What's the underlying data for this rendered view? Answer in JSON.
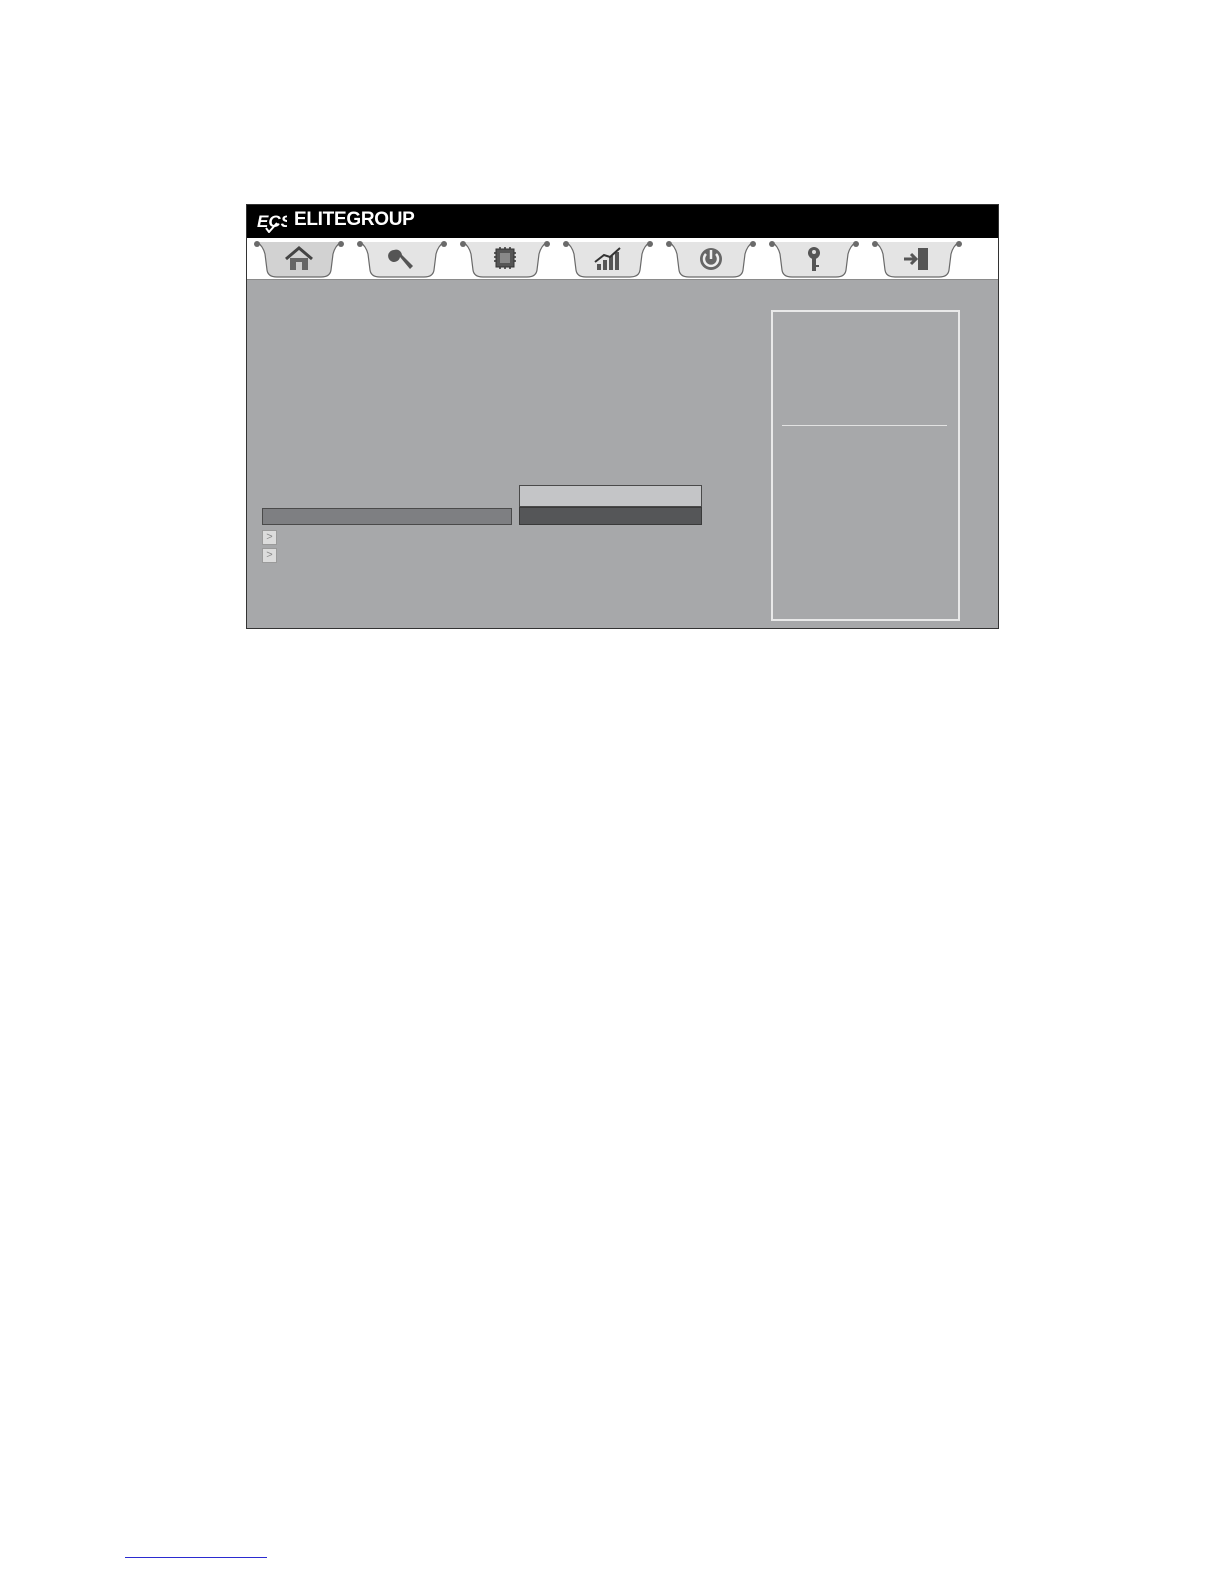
{
  "header": {
    "brand_text": "ELITEGROUP",
    "logo_icon": "ecs-logo-icon"
  },
  "tabs": [
    {
      "icon": "home-icon",
      "active": true
    },
    {
      "icon": "wrench-icon"
    },
    {
      "icon": "chip-icon"
    },
    {
      "icon": "performance-chart-icon"
    },
    {
      "icon": "power-icon"
    },
    {
      "icon": "key-icon"
    },
    {
      "icon": "exit-icon"
    }
  ],
  "submenu_items": [
    {
      "arrow_glyph": ">"
    },
    {
      "arrow_glyph": ">"
    }
  ],
  "colors": {
    "title_bar": "#000000",
    "content_background": "#a7a8aa",
    "selected_value": "#555658",
    "highlight": "#7e7f82"
  }
}
